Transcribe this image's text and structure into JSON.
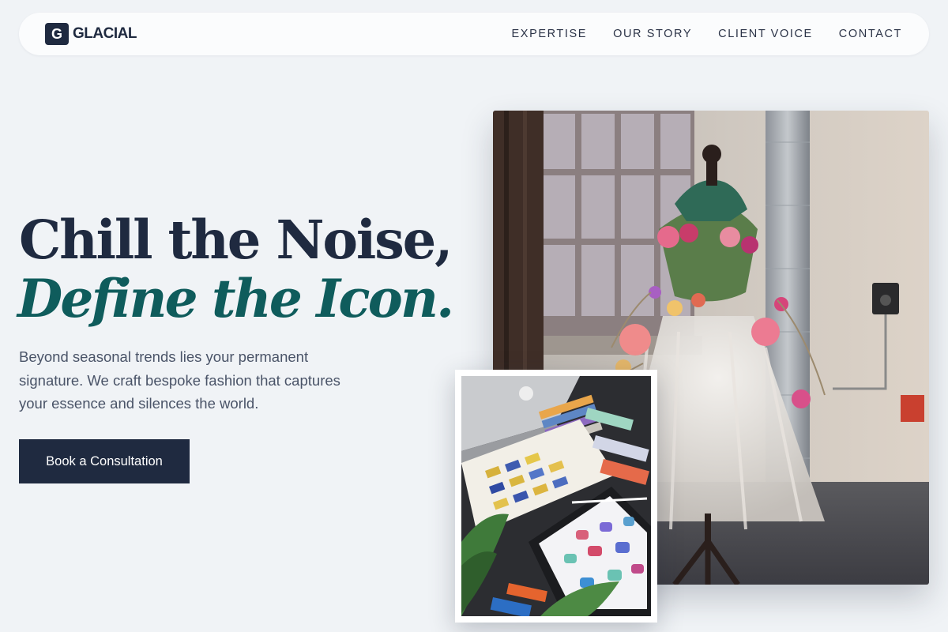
{
  "brand": {
    "mark": "G",
    "name": "GLACIAL"
  },
  "nav": {
    "links": [
      {
        "label": "EXPERTISE"
      },
      {
        "label": "OUR STORY"
      },
      {
        "label": "CLIENT VOICE"
      },
      {
        "label": "CONTACT"
      }
    ]
  },
  "hero": {
    "title": "Chill the Noise,",
    "title_accent": "Define the Icon.",
    "description": "Beyond seasonal trends lies your permanent signature. We craft bespoke fashion that captures your essence and silences the world.",
    "cta_label": "Book a Consultation"
  },
  "images": {
    "main_icon": "floral-dress-mannequin-photo",
    "inset_icon": "color-swatches-sketch-photo"
  },
  "colors": {
    "background": "#f0f3f6",
    "primary": "#1f2a40",
    "accent": "#0f5c5c",
    "text_muted": "#4a5468"
  }
}
